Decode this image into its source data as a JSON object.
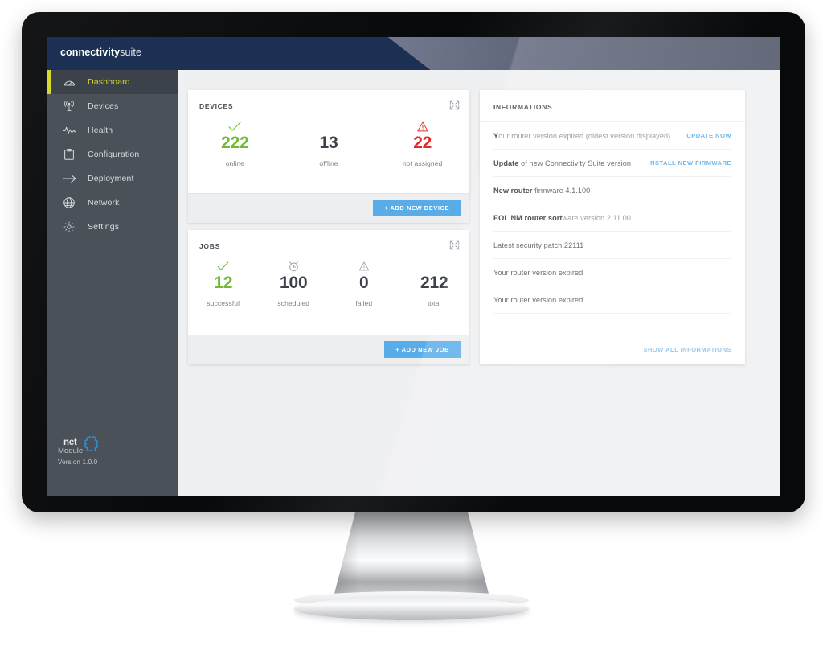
{
  "app": {
    "brand_bold": "connectivity",
    "brand_light": "suite"
  },
  "sidebar": {
    "items": [
      {
        "label": "Dashboard",
        "icon": "gauge-icon",
        "active": true
      },
      {
        "label": "Devices",
        "icon": "antenna-icon",
        "active": false
      },
      {
        "label": "Health",
        "icon": "pulse-icon",
        "active": false
      },
      {
        "label": "Configuration",
        "icon": "clipboard-icon",
        "active": false
      },
      {
        "label": "Deployment",
        "icon": "arrow-right-icon",
        "active": false
      },
      {
        "label": "Network",
        "icon": "globe-icon",
        "active": false
      },
      {
        "label": "Settings",
        "icon": "gear-icon",
        "active": false
      }
    ],
    "footer": {
      "logo_net": "net",
      "logo_module": "Module",
      "version": "Version 1.0.0"
    }
  },
  "devices_card": {
    "title": "DEVICES",
    "expand_icon": "expand-icon",
    "stats": [
      {
        "icon": "check-icon",
        "value": "222",
        "label": "online",
        "color": "green"
      },
      {
        "icon": "",
        "value": "13",
        "label": "offline",
        "color": "dark"
      },
      {
        "icon": "warning-icon",
        "value": "22",
        "label": "not assigned",
        "color": "red"
      }
    ],
    "button_label": "+ ADD NEW DEVICE"
  },
  "jobs_card": {
    "title": "JOBS",
    "expand_icon": "expand-icon",
    "stats": [
      {
        "icon": "check-icon",
        "value": "12",
        "label": "successful",
        "color": "green"
      },
      {
        "icon": "clock-icon",
        "value": "100",
        "label": "scheduled",
        "color": "dark"
      },
      {
        "icon": "warning-icon",
        "value": "0",
        "label": "failed",
        "color": "dark"
      },
      {
        "icon": "",
        "value": "212",
        "label": "total",
        "color": "dark"
      }
    ],
    "button_label": "+ ADD NEW JOB"
  },
  "informations": {
    "title": "INFORMATIONS",
    "rows": [
      {
        "bold": "Y",
        "rest": "our router version expired (oldest version displayed)",
        "action": "UPDATE NOW"
      },
      {
        "bold": "Update",
        "rest": " of new Connectivity Suite version",
        "action": "INSTALL NEW FIRMWARE"
      },
      {
        "bold": "New router",
        "rest": " firmware 4.1.100",
        "action": ""
      },
      {
        "bold": "EOL NM router sort",
        "rest": "ware version 2.11.00",
        "action": ""
      },
      {
        "bold": "",
        "rest": "Latest security patch 22111",
        "action": ""
      },
      {
        "bold": "",
        "rest": "Your router version expired",
        "action": ""
      },
      {
        "bold": "",
        "rest": "Your router version expired",
        "action": ""
      }
    ],
    "footer_label": "SHOW ALL INFORMATIONS"
  },
  "colors": {
    "accent_yellow": "#d6d82b",
    "brand_navy": "#1b3052",
    "sidebar": "#4b5159",
    "button_blue": "#5aace9",
    "green": "#72bb36",
    "red": "#e02b27"
  }
}
